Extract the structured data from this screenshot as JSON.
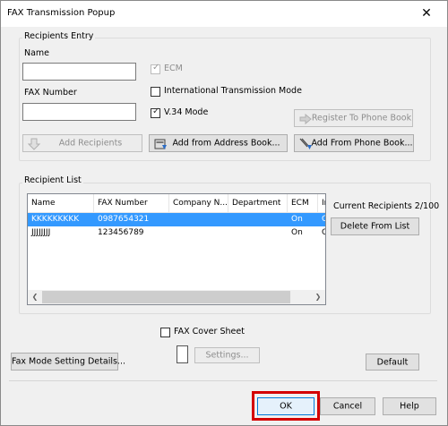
{
  "window": {
    "title": "FAX Transmission Popup",
    "close_glyph": "✕"
  },
  "recipients_entry": {
    "group_label": "Recipients Entry",
    "name_label": "Name",
    "name_value": "",
    "fax_label": "FAX Number",
    "fax_value": "",
    "ecm_label": "ECM",
    "ecm_checked": true,
    "intl_label": "International Transmission Mode",
    "intl_checked": false,
    "v34_label": "V.34 Mode",
    "v34_checked": true,
    "register_label": "Register To Phone Book",
    "add_recipients_label": "Add Recipients",
    "add_address_label": "Add from Address Book...",
    "add_phone_label": "Add From Phone Book..."
  },
  "recipient_list": {
    "group_label": "Recipient List",
    "columns": [
      "Name",
      "FAX Number",
      "Company N...",
      "Department",
      "ECM",
      "In"
    ],
    "rows": [
      {
        "name": "KKKKKKKKK",
        "fax": "0987654321",
        "company": "",
        "department": "",
        "ecm": "On",
        "intl": "Of",
        "selected": true
      },
      {
        "name": "JJJJJJJJ",
        "fax": "123456789",
        "company": "",
        "department": "",
        "ecm": "On",
        "intl": "Of",
        "selected": false
      }
    ],
    "current_recipients": "Current Recipients 2/100",
    "delete_label": "Delete From List"
  },
  "cover_sheet": {
    "label": "FAX Cover Sheet",
    "checked": false,
    "settings_label": "Settings..."
  },
  "fax_mode_label": "Fax Mode Setting Details...",
  "default_label": "Default",
  "footer": {
    "ok_label": "OK",
    "cancel_label": "Cancel",
    "help_label": "Help"
  },
  "colors": {
    "selection": "#3399ff",
    "highlight": "#d40000"
  }
}
